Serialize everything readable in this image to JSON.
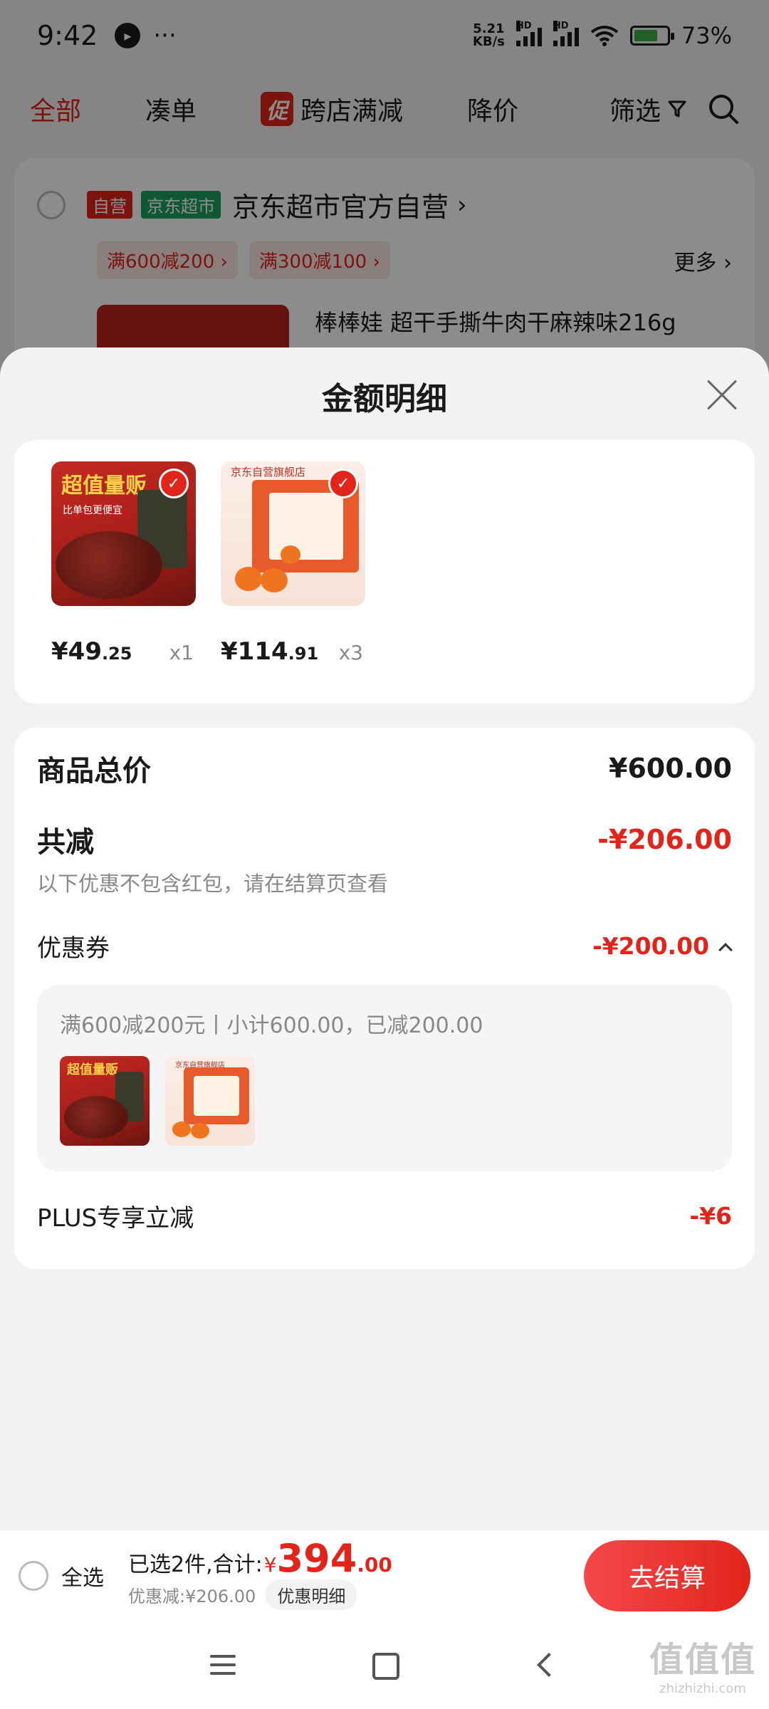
{
  "status_bar": {
    "time": "9:42",
    "more": "···",
    "net_speed_value": "5.21",
    "net_speed_unit": "KB/s",
    "hd_label": "HD",
    "battery_pct": "73%",
    "battery_level": 0.73
  },
  "top_tabs": {
    "all": "全部",
    "bundle": "凑单",
    "promo_badge": "促",
    "cross_store": "跨店满减",
    "price_drop": "降价",
    "filter": "筛选"
  },
  "store": {
    "tag_self": "自营",
    "tag_market": "京东超市",
    "name": "京东超市官方自营",
    "promos": [
      "满600减200 ›",
      "满300减100 ›"
    ],
    "more": "更多 ›",
    "product_title": "棒棒娃 超干手撕牛肉干麻辣味216g"
  },
  "sheet": {
    "title": "金额明细",
    "products": [
      {
        "name": "beef-jerky",
        "img_text": "超值量贩",
        "img_sub": "比单包更便宜",
        "price_main": "¥49",
        "price_dec": ".25",
        "qty": "x1"
      },
      {
        "name": "persimmon-gift",
        "img_text": "京东自营旗舰店",
        "price_main": "¥114",
        "price_dec": ".91",
        "qty": "x3"
      }
    ],
    "total_label": "商品总价",
    "total_value": "¥600.00",
    "discount_label": "共减",
    "discount_value": "-¥206.00",
    "discount_note": "以下优惠不包含红包，请在结算页查看",
    "coupon_label": "优惠券",
    "coupon_value": "-¥200.00",
    "coupon_desc": "满600减200元丨小计600.00，已减200.00",
    "plus_label": "PLUS专享立减",
    "plus_value": "-¥6"
  },
  "checkout": {
    "select_all": "全选",
    "selected_text": "已选2件,合计:",
    "total_symbol": "¥",
    "total_int": "394",
    "total_dec": ".00",
    "discount_text": "优惠减:¥206.00",
    "detail_chip": "优惠明细",
    "button": "去结算"
  },
  "watermark": {
    "main": "值值值",
    "sub": "zhizhizhi.com"
  },
  "colors": {
    "accent_red": "#e1251b",
    "market_green": "#1aa260"
  }
}
